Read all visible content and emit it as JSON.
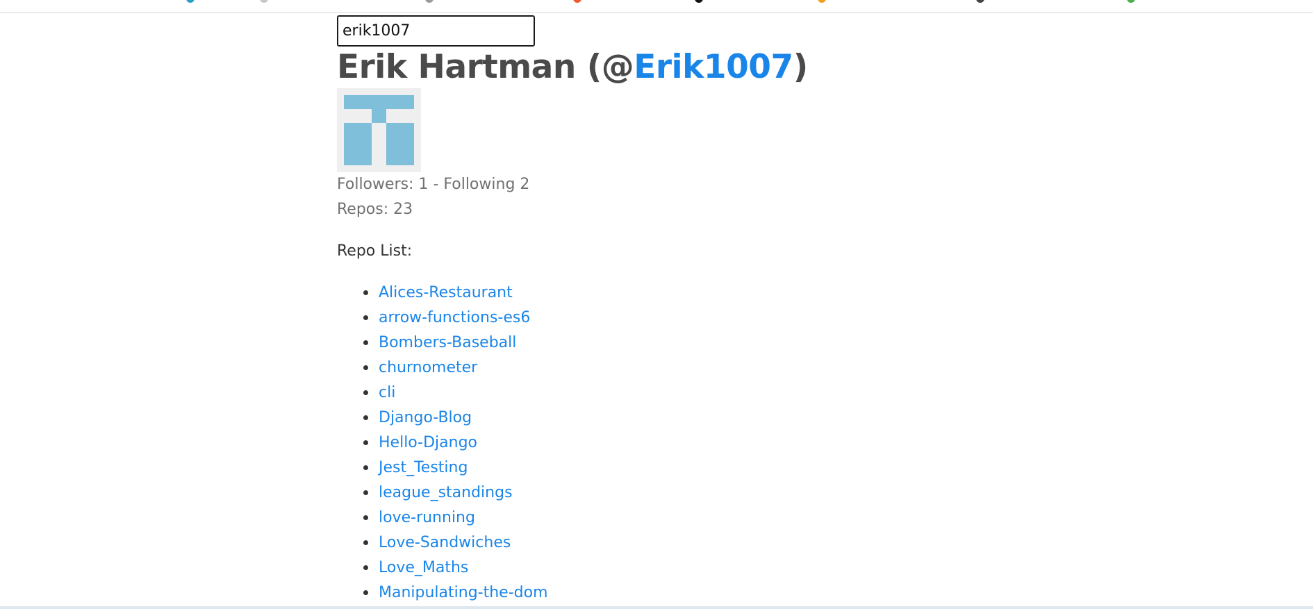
{
  "search": {
    "value": "erik1007"
  },
  "profile": {
    "name_prefix": "Erik Hartman (@",
    "username": "Erik1007",
    "name_suffix": ")",
    "followers_text": "Followers: 1 - Following 2",
    "repos_text": "Repos: 23"
  },
  "repo_list": {
    "heading": "Repo List:",
    "items": [
      "Alices-Restaurant",
      "arrow-functions-es6",
      "Bombers-Baseball",
      "churnometer",
      "cli",
      "Django-Blog",
      "Hello-Django",
      "Jest_Testing",
      "league_standings",
      "love-running",
      "Love-Sandwiches",
      "Love_Maths",
      "Manipulating-the-dom"
    ]
  },
  "colors": {
    "link": "#1a85e8",
    "text": "#4a4a4a",
    "muted": "#707070",
    "avatar_bg": "#efefef",
    "avatar_fg": "#7fbfda"
  },
  "icons": {
    "avatar": "identicon-avatar"
  }
}
